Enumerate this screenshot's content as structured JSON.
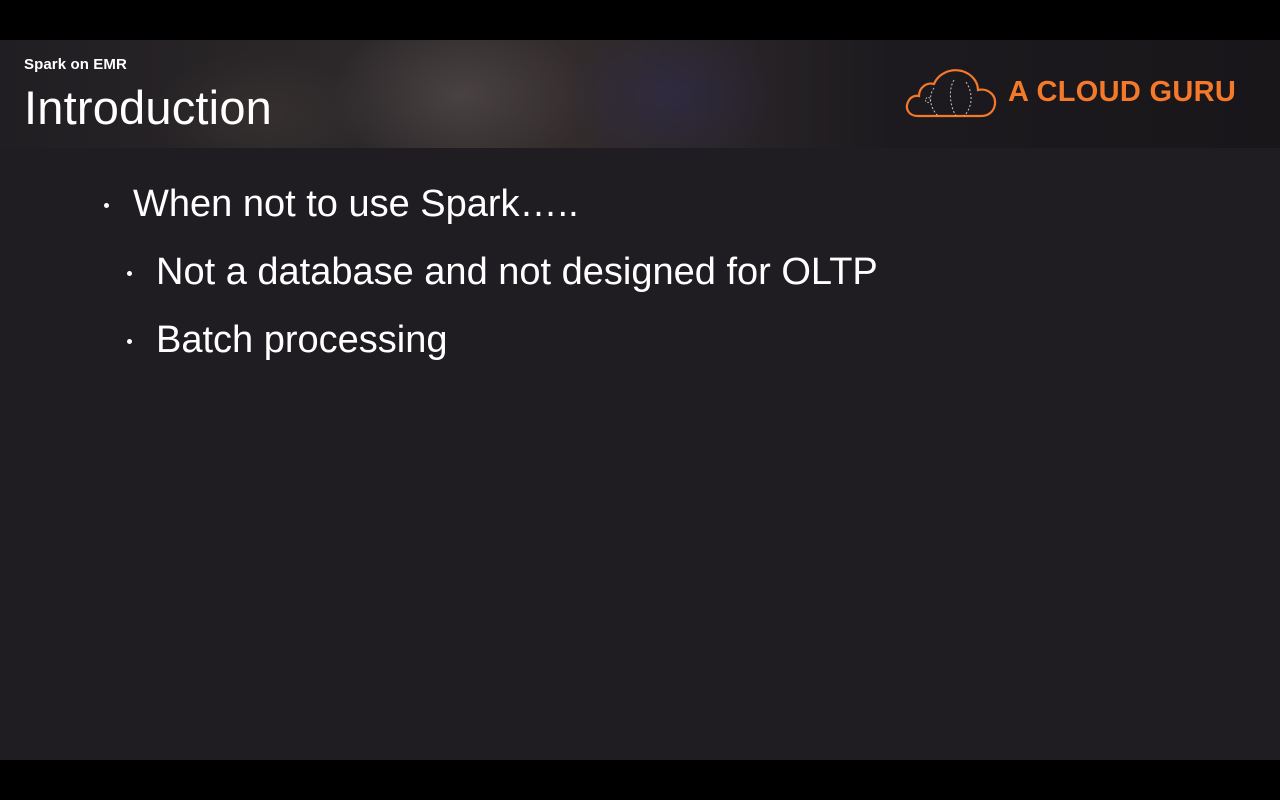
{
  "header": {
    "subtitle": "Spark on EMR",
    "title": "Introduction",
    "logo_text": "A CLOUD GURU",
    "logo_icon": "cloud-logo-icon"
  },
  "content": {
    "bullets": [
      {
        "level": 1,
        "text": "When not to use Spark….."
      },
      {
        "level": 2,
        "text": "Not a database and not designed for OLTP"
      },
      {
        "level": 2,
        "text": "Batch processing"
      }
    ]
  },
  "colors": {
    "background": "#1f1d21",
    "brand_orange": "#f4792b",
    "text": "#ffffff"
  }
}
